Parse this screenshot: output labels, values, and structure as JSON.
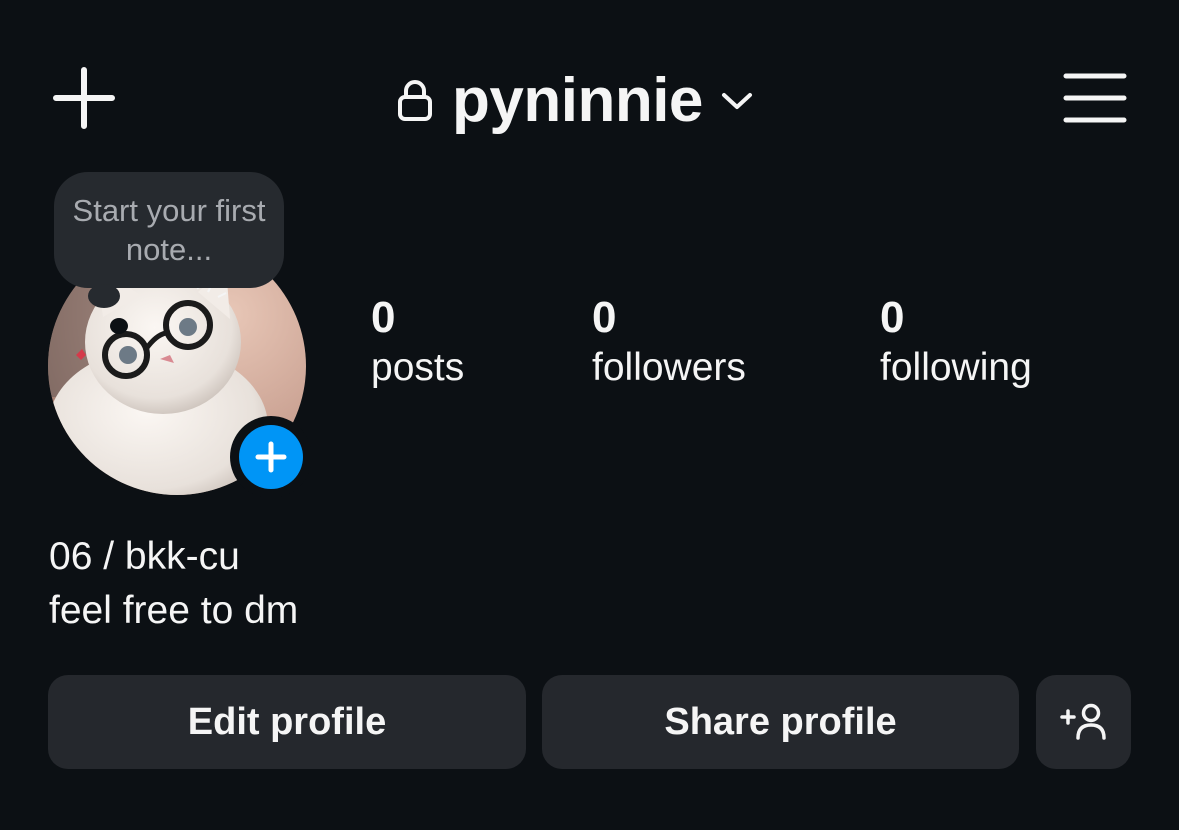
{
  "header": {
    "username": "pyninnie",
    "new_icon": "plus-icon",
    "lock_icon": "lock-icon",
    "dropdown_icon": "chevron-down-icon",
    "menu_icon": "hamburger-menu-icon"
  },
  "note": {
    "placeholder": "Start your first note..."
  },
  "stats": [
    {
      "count": "0",
      "label": "posts"
    },
    {
      "count": "0",
      "label": "followers"
    },
    {
      "count": "0",
      "label": "following"
    }
  ],
  "bio": {
    "line1": "06 / bkk-cu",
    "line2": "feel free to dm"
  },
  "actions": {
    "edit_label": "Edit profile",
    "share_label": "Share profile",
    "suggest_icon": "add-person-icon"
  },
  "colors": {
    "background": "#0c1014",
    "button": "#25282d",
    "accent": "#0095f6"
  }
}
